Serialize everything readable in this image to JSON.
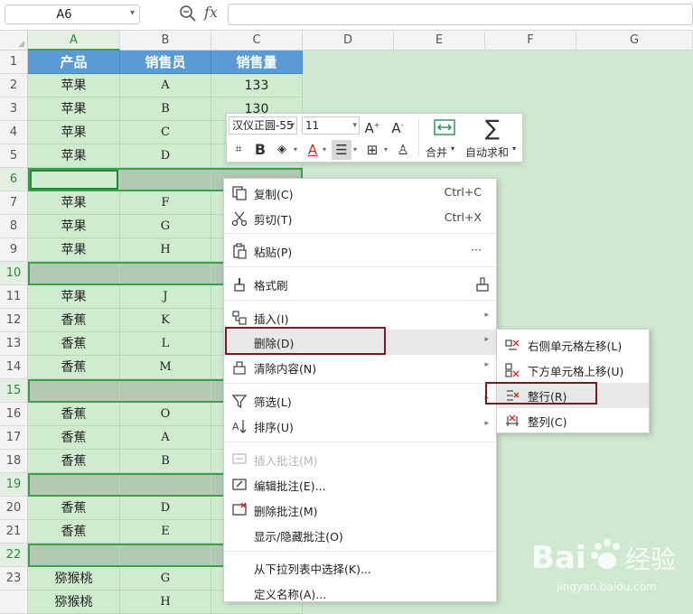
{
  "formula_bar": {
    "name_box": "A6",
    "fx_label": "fx",
    "formula_value": ""
  },
  "columns": [
    "A",
    "B",
    "C",
    "D",
    "E",
    "F",
    "G"
  ],
  "rows": [
    "1",
    "2",
    "3",
    "4",
    "5",
    "6",
    "7",
    "8",
    "9",
    "10",
    "11",
    "12",
    "13",
    "14",
    "15",
    "16",
    "17",
    "18",
    "19",
    "20",
    "21",
    "22",
    "23",
    ""
  ],
  "table": {
    "headers": [
      "产品",
      "销售员",
      "销售量"
    ],
    "cells": [
      [
        "苹果",
        "A",
        "133"
      ],
      [
        "苹果",
        "B",
        "130"
      ],
      [
        "苹果",
        "C",
        ""
      ],
      [
        "苹果",
        "D",
        ""
      ],
      [
        "",
        "",
        ""
      ],
      [
        "苹果",
        "F",
        ""
      ],
      [
        "苹果",
        "G",
        ""
      ],
      [
        "苹果",
        "H",
        ""
      ],
      [
        "",
        "",
        ""
      ],
      [
        "苹果",
        "J",
        ""
      ],
      [
        "香蕉",
        "K",
        ""
      ],
      [
        "香蕉",
        "L",
        ""
      ],
      [
        "香蕉",
        "M",
        ""
      ],
      [
        "",
        "",
        ""
      ],
      [
        "香蕉",
        "O",
        ""
      ],
      [
        "香蕉",
        "A",
        ""
      ],
      [
        "香蕉",
        "B",
        ""
      ],
      [
        "",
        "",
        ""
      ],
      [
        "香蕉",
        "D",
        ""
      ],
      [
        "香蕉",
        "E",
        ""
      ],
      [
        "",
        "",
        ""
      ],
      [
        "猕猴桃",
        "G",
        ""
      ],
      [
        "猕猴桃",
        "H",
        ""
      ]
    ]
  },
  "mini_toolbar": {
    "font_name": "汉仪正圆-55",
    "font_size": "11",
    "merge_label": "合并",
    "autosum_label": "自动求和"
  },
  "context_menu": {
    "items": [
      {
        "label": "复制(C)",
        "shortcut": "Ctrl+C"
      },
      {
        "label": "剪切(T)",
        "shortcut": "Ctrl+X"
      },
      {
        "label": "粘贴(P)",
        "shortcut": "···"
      },
      {
        "label": "格式刷",
        "shortcut": ""
      },
      {
        "label": "插入(I)",
        "shortcut": ""
      },
      {
        "label": "删除(D)",
        "shortcut": ""
      },
      {
        "label": "清除内容(N)",
        "shortcut": ""
      },
      {
        "label": "筛选(L)",
        "shortcut": ""
      },
      {
        "label": "排序(U)",
        "shortcut": ""
      },
      {
        "label": "插入批注(M)",
        "shortcut": ""
      },
      {
        "label": "编辑批注(E)...",
        "shortcut": ""
      },
      {
        "label": "删除批注(M)",
        "shortcut": ""
      },
      {
        "label": "显示/隐藏批注(O)",
        "shortcut": ""
      },
      {
        "label": "从下拉列表中选择(K)...",
        "shortcut": ""
      },
      {
        "label": "定义名称(A)...",
        "shortcut": ""
      }
    ]
  },
  "delete_submenu": {
    "items": [
      {
        "label": "右侧单元格左移(L)"
      },
      {
        "label": "下方单元格上移(U)"
      },
      {
        "label": "整行(R)"
      },
      {
        "label": "整列(C)"
      }
    ]
  },
  "watermark": {
    "brand_latin": "Bai",
    "brand_cn": "经验",
    "url": "jingyan.baidu.com"
  },
  "colors": {
    "header_fill": "#5b9bd5",
    "data_fill": "#d0eccf",
    "blank_row_fill": "#b2c8b3",
    "highlight_box": "#7a1a1a"
  }
}
